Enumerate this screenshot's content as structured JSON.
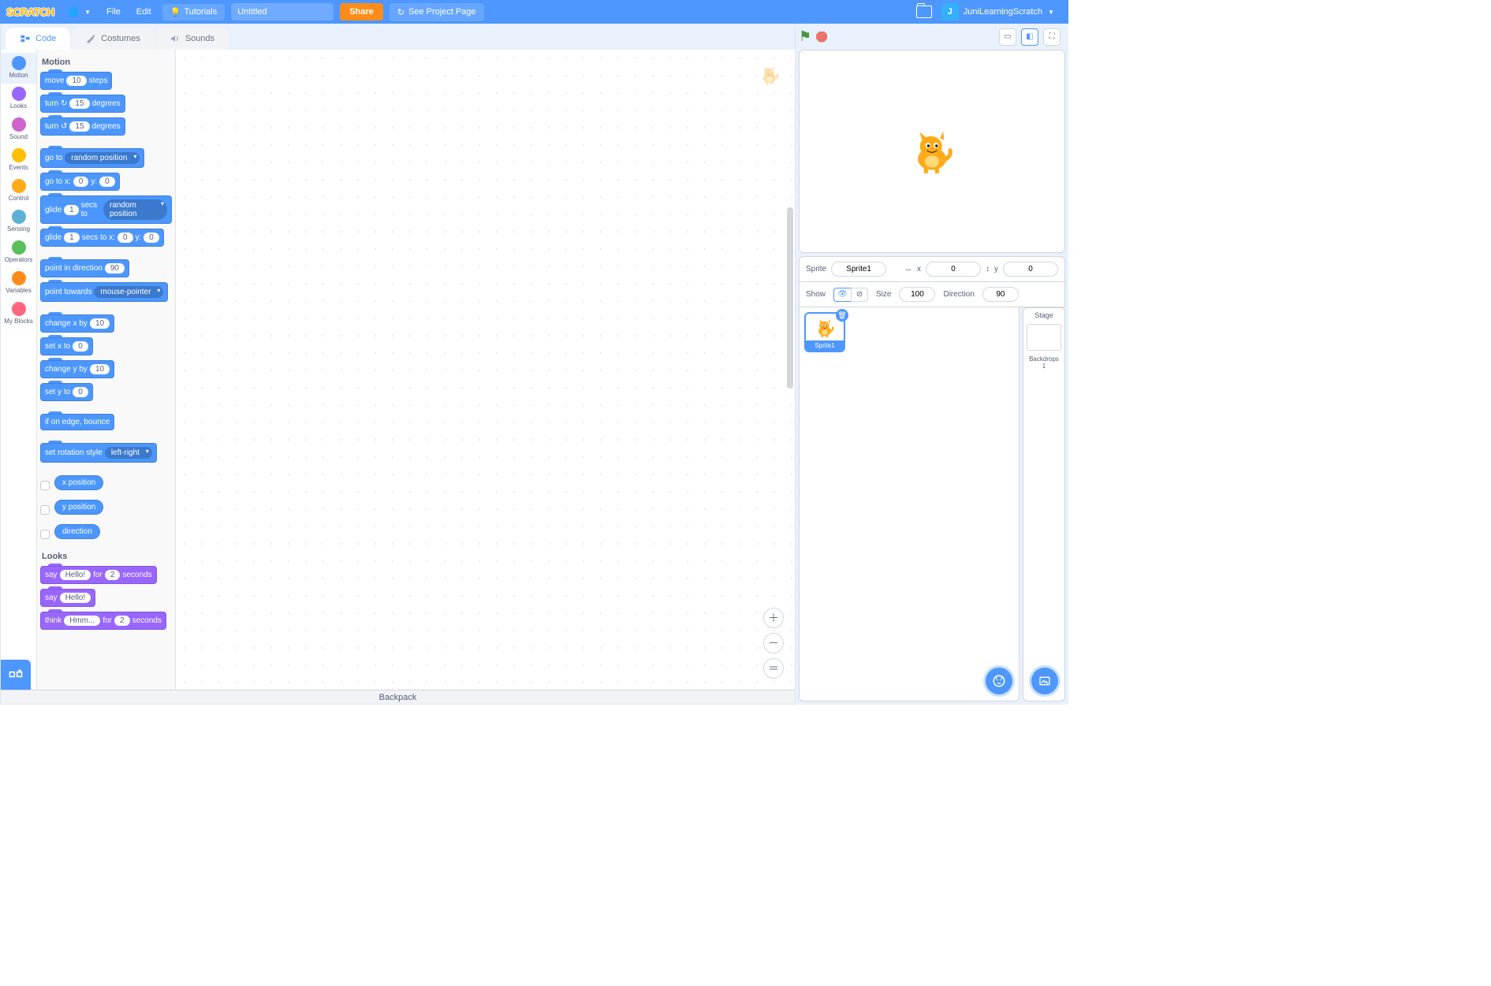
{
  "menubar": {
    "logo": "SCRATCH",
    "language": "🌐",
    "file": "File",
    "edit": "Edit",
    "tutorials": "Tutorials",
    "title_value": "Untitled",
    "share": "Share",
    "see_page": "See Project Page",
    "username": "JuniLearningScratch",
    "avatar_letter": "J"
  },
  "tabs": {
    "code": "Code",
    "costumes": "Costumes",
    "sounds": "Sounds"
  },
  "categories": [
    {
      "name": "Motion",
      "color": "#4c97ff"
    },
    {
      "name": "Looks",
      "color": "#9966ff"
    },
    {
      "name": "Sound",
      "color": "#cf63cf"
    },
    {
      "name": "Events",
      "color": "#ffbf00"
    },
    {
      "name": "Control",
      "color": "#ffab19"
    },
    {
      "name": "Sensing",
      "color": "#5cb1d6"
    },
    {
      "name": "Operators",
      "color": "#59c059"
    },
    {
      "name": "Variables",
      "color": "#ff8c1a"
    },
    {
      "name": "My Blocks",
      "color": "#ff6680"
    }
  ],
  "palette": {
    "motion_heading": "Motion",
    "looks_heading": "Looks",
    "blocks": {
      "move_a": "move",
      "move_v": "10",
      "move_b": "steps",
      "turncw_a": "turn ↻",
      "turncw_v": "15",
      "turncw_b": "degrees",
      "turnccw_a": "turn ↺",
      "turnccw_v": "15",
      "turnccw_b": "degrees",
      "goto_a": "go to",
      "goto_v": "random position",
      "gotoxy_a": "go to x:",
      "gotoxy_x": "0",
      "gotoxy_b": "y:",
      "gotoxy_y": "0",
      "glideto_a": "glide",
      "glideto_v": "1",
      "glideto_b": "secs to",
      "glideto_d": "random position",
      "glidexy_a": "glide",
      "glidexy_s": "1",
      "glidexy_b": "secs to x:",
      "glidexy_x": "0",
      "glidexy_c": "y:",
      "glidexy_y": "0",
      "pointdir_a": "point in direction",
      "pointdir_v": "90",
      "pointtw_a": "point towards",
      "pointtw_v": "mouse-pointer",
      "chx_a": "change x by",
      "chx_v": "10",
      "setx_a": "set x to",
      "setx_v": "0",
      "chy_a": "change y by",
      "chy_v": "10",
      "sety_a": "set y to",
      "sety_v": "0",
      "edge": "if on edge, bounce",
      "rot_a": "set rotation style",
      "rot_v": "left-right",
      "rep_x": "x position",
      "rep_y": "y position",
      "rep_d": "direction",
      "sayfor_a": "say",
      "sayfor_t": "Hello!",
      "sayfor_b": "for",
      "sayfor_s": "2",
      "sayfor_c": "seconds",
      "say_a": "say",
      "say_t": "Hello!",
      "thinkfor_a": "think",
      "thinkfor_t": "Hmm...",
      "thinkfor_b": "for",
      "thinkfor_s": "2",
      "thinkfor_c": "seconds"
    }
  },
  "sprite_panel": {
    "sprite_label": "Sprite",
    "sprite_name": "Sprite1",
    "x_label": "x",
    "x_val": "0",
    "y_label": "y",
    "y_val": "0",
    "show_label": "Show",
    "size_label": "Size",
    "size_val": "100",
    "dir_label": "Direction",
    "dir_val": "90"
  },
  "stage_panel": {
    "title": "Stage",
    "backdrops_label": "Backdrops",
    "backdrops_count": "1"
  },
  "backpack": "Backpack"
}
